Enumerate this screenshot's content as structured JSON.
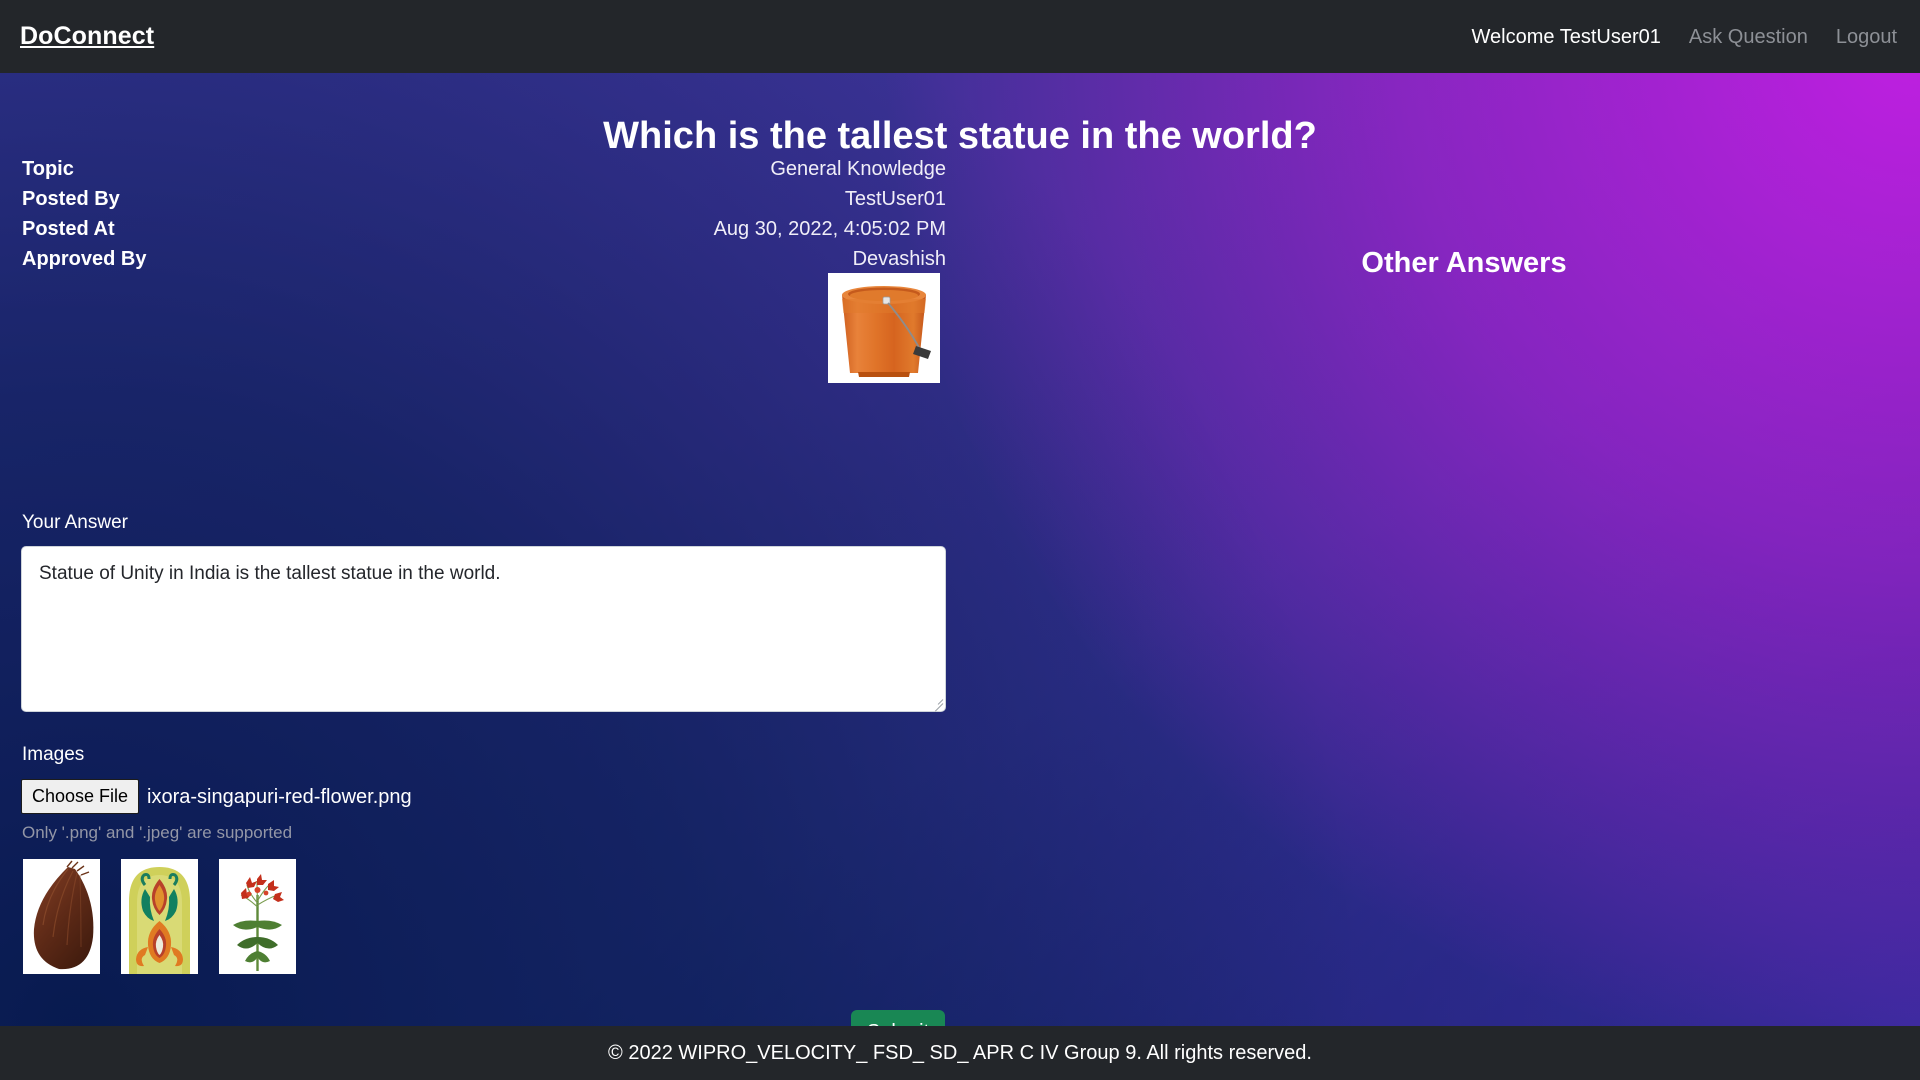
{
  "navbar": {
    "brand": "DoConnect",
    "welcome": "Welcome TestUser01",
    "ask_question": "Ask Question",
    "logout": "Logout"
  },
  "question": {
    "title": "Which is the tallest statue in the world?",
    "meta": [
      {
        "label": "Topic",
        "value": "General Knowledge"
      },
      {
        "label": "Posted By",
        "value": "TestUser01"
      },
      {
        "label": "Posted At",
        "value": "Aug 30, 2022, 4:05:02 PM"
      },
      {
        "label": "Approved By",
        "value": "Devashish"
      }
    ],
    "image_alt": "orange-bucket-image"
  },
  "answer_form": {
    "answer_label": "Your Answer",
    "answer_value": "Statue of Unity in India is the tallest statue in the world.",
    "answer_placeholder": "",
    "images_label": "Images",
    "choose_file_label": "Choose File",
    "selected_file": "ixora-singapuri-red-flower.png",
    "file_hint": "Only '.png' and '.jpeg' are supported",
    "thumbnails": [
      {
        "alt": "coconut-thumbnail"
      },
      {
        "alt": "ornament-pattern-thumbnail"
      },
      {
        "alt": "red-flower-plant-thumbnail"
      }
    ],
    "submit_label": "Submit"
  },
  "right_panel": {
    "heading": "Other Answers"
  },
  "footer": {
    "text": "© 2022 WIPRO_VELOCITY_ FSD_ SD_ APR C IV Group 9. All rights reserved."
  },
  "colors": {
    "navbar_bg": "#23262a",
    "footer_bg": "#23262a",
    "submit_green": "#198754",
    "gradient_magenta": "#c81ee6",
    "gradient_indigo": "#3a3598",
    "gradient_navy": "#0d2156",
    "muted_text": "#8d9096"
  }
}
